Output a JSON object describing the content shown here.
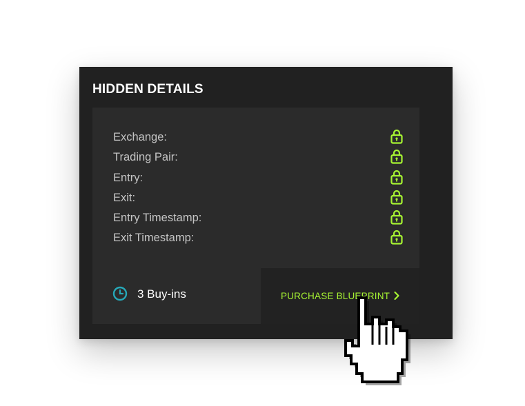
{
  "card": {
    "title": "HIDDEN DETAILS"
  },
  "details": [
    {
      "label": "Exchange:",
      "icon": "lock-icon",
      "locked": true
    },
    {
      "label": "Trading Pair:",
      "icon": "lock-icon",
      "locked": true
    },
    {
      "label": "Entry:",
      "icon": "lock-icon",
      "locked": true
    },
    {
      "label": "Exit:",
      "icon": "lock-icon",
      "locked": true
    },
    {
      "label": "Entry Timestamp:",
      "icon": "lock-icon",
      "locked": true
    },
    {
      "label": "Exit Timestamp:",
      "icon": "lock-icon",
      "locked": true
    }
  ],
  "footer": {
    "buyins_label": "3 Buy-ins",
    "buyins_icon": "clock-icon",
    "purchase_label": "PURCHASE BLUEPRINT",
    "purchase_icon": "chevron-right-icon"
  },
  "cursor": {
    "icon": "hand-cursor-icon"
  },
  "colors": {
    "card_background": "#212121",
    "panel_background": "#2b2b2b",
    "accent_green": "#a7f432",
    "clock_teal": "#26a8b8",
    "label_gray": "#c4c4c4"
  }
}
